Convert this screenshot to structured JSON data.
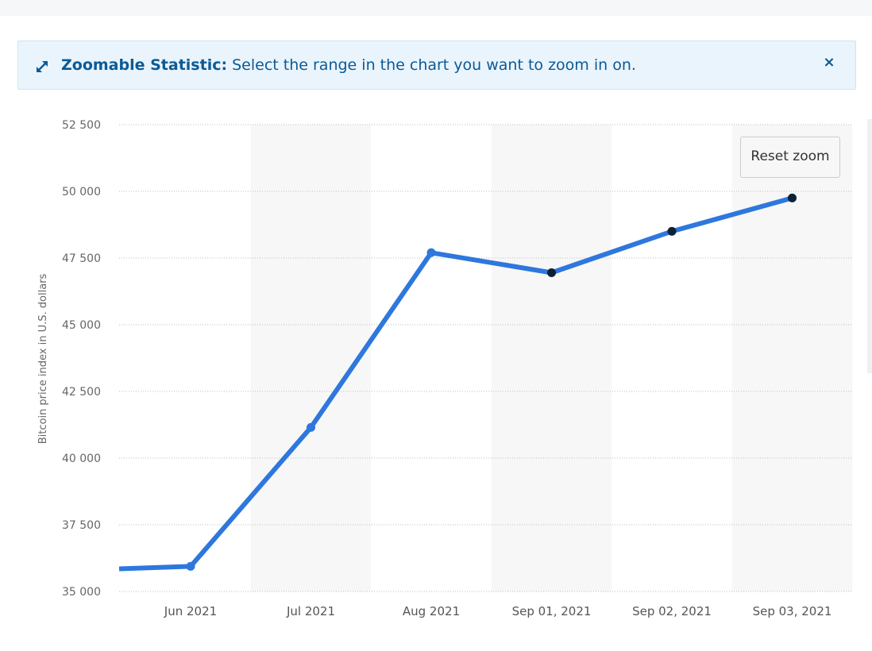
{
  "banner": {
    "title": "Zoomable Statistic:",
    "message": "Select the range in the chart you want to zoom in on.",
    "close_label": "×",
    "icon": "expand-arrows-icon"
  },
  "reset_zoom_label": "Reset zoom",
  "colors": {
    "line": "#2e77dd",
    "marker_selected": "#0d2136",
    "band": "#f7f7f7",
    "accent": "#0b5a96"
  },
  "chart_data": {
    "type": "line",
    "ylabel": "Bitcoin price index in U.S. dollars",
    "xlabel": "",
    "ylim": [
      35000,
      52500
    ],
    "y_ticks": [
      "35 000",
      "37 500",
      "40 000",
      "42 500",
      "45 000",
      "47 500",
      "50 000",
      "52 500"
    ],
    "categories": [
      "Jun 2021",
      "Jul 2021",
      "Aug 2021",
      "Sep 01, 2021",
      "Sep 02, 2021",
      "Sep 03, 2021"
    ],
    "series": [
      {
        "values": [
          35940,
          41150,
          47700,
          46950,
          48500,
          49750
        ],
        "lead_in_value": 35850
      }
    ],
    "alternate_bands": true,
    "grid": true
  }
}
